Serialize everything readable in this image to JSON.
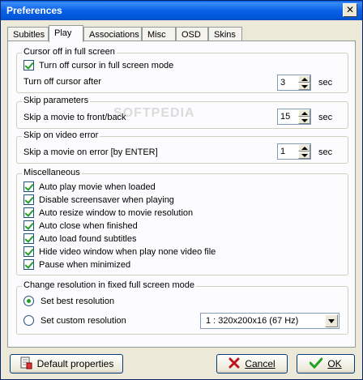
{
  "window": {
    "title": "Preferences",
    "close_glyph": "✕"
  },
  "tabs": [
    {
      "label": "Subitles"
    },
    {
      "label": "Play",
      "active": true
    },
    {
      "label": "Associations"
    },
    {
      "label": "Misc"
    },
    {
      "label": "OSD"
    },
    {
      "label": "Skins"
    }
  ],
  "cursor_group": {
    "label": "Cursor off in full screen",
    "check_label": "Turn off cursor in full screen mode",
    "check_checked": true,
    "delay_label": "Turn off cursor after",
    "delay_value": "3",
    "delay_unit": "sec"
  },
  "skip_group": {
    "label": "Skip parameters",
    "row_label": "Skip a movie to front/back",
    "value": "15",
    "unit": "sec"
  },
  "error_group": {
    "label": "Skip on video error",
    "row_label": "Skip a movie on error [by ENTER]",
    "value": "1",
    "unit": "sec"
  },
  "misc_group": {
    "label": "Miscellaneous",
    "items": [
      {
        "label": "Auto play movie when loaded",
        "checked": true
      },
      {
        "label": "Disable screensaver when playing",
        "checked": true
      },
      {
        "label": "Auto resize window to movie resolution",
        "checked": true
      },
      {
        "label": "Auto close when finished",
        "checked": true
      },
      {
        "label": "Auto load found subtitles",
        "checked": true
      },
      {
        "label": "Hide video window when play none video file",
        "checked": true
      },
      {
        "label": "Pause when minimized",
        "checked": true
      }
    ]
  },
  "resolution_group": {
    "label": "Change resolution in fixed full screen mode",
    "best_label": "Set best resolution",
    "custom_label": "Set custom resolution",
    "selected": "best",
    "custom_value": "1 : 320x200x16 (67 Hz)"
  },
  "footer": {
    "default_label": "Default properties",
    "cancel_label": "Cancel",
    "ok_label": "OK"
  },
  "watermark": "SOFTPEDIA",
  "colors": {
    "titlebar": "#0a61e8",
    "check": "#21a121",
    "cancel_x": "#c0141c"
  }
}
